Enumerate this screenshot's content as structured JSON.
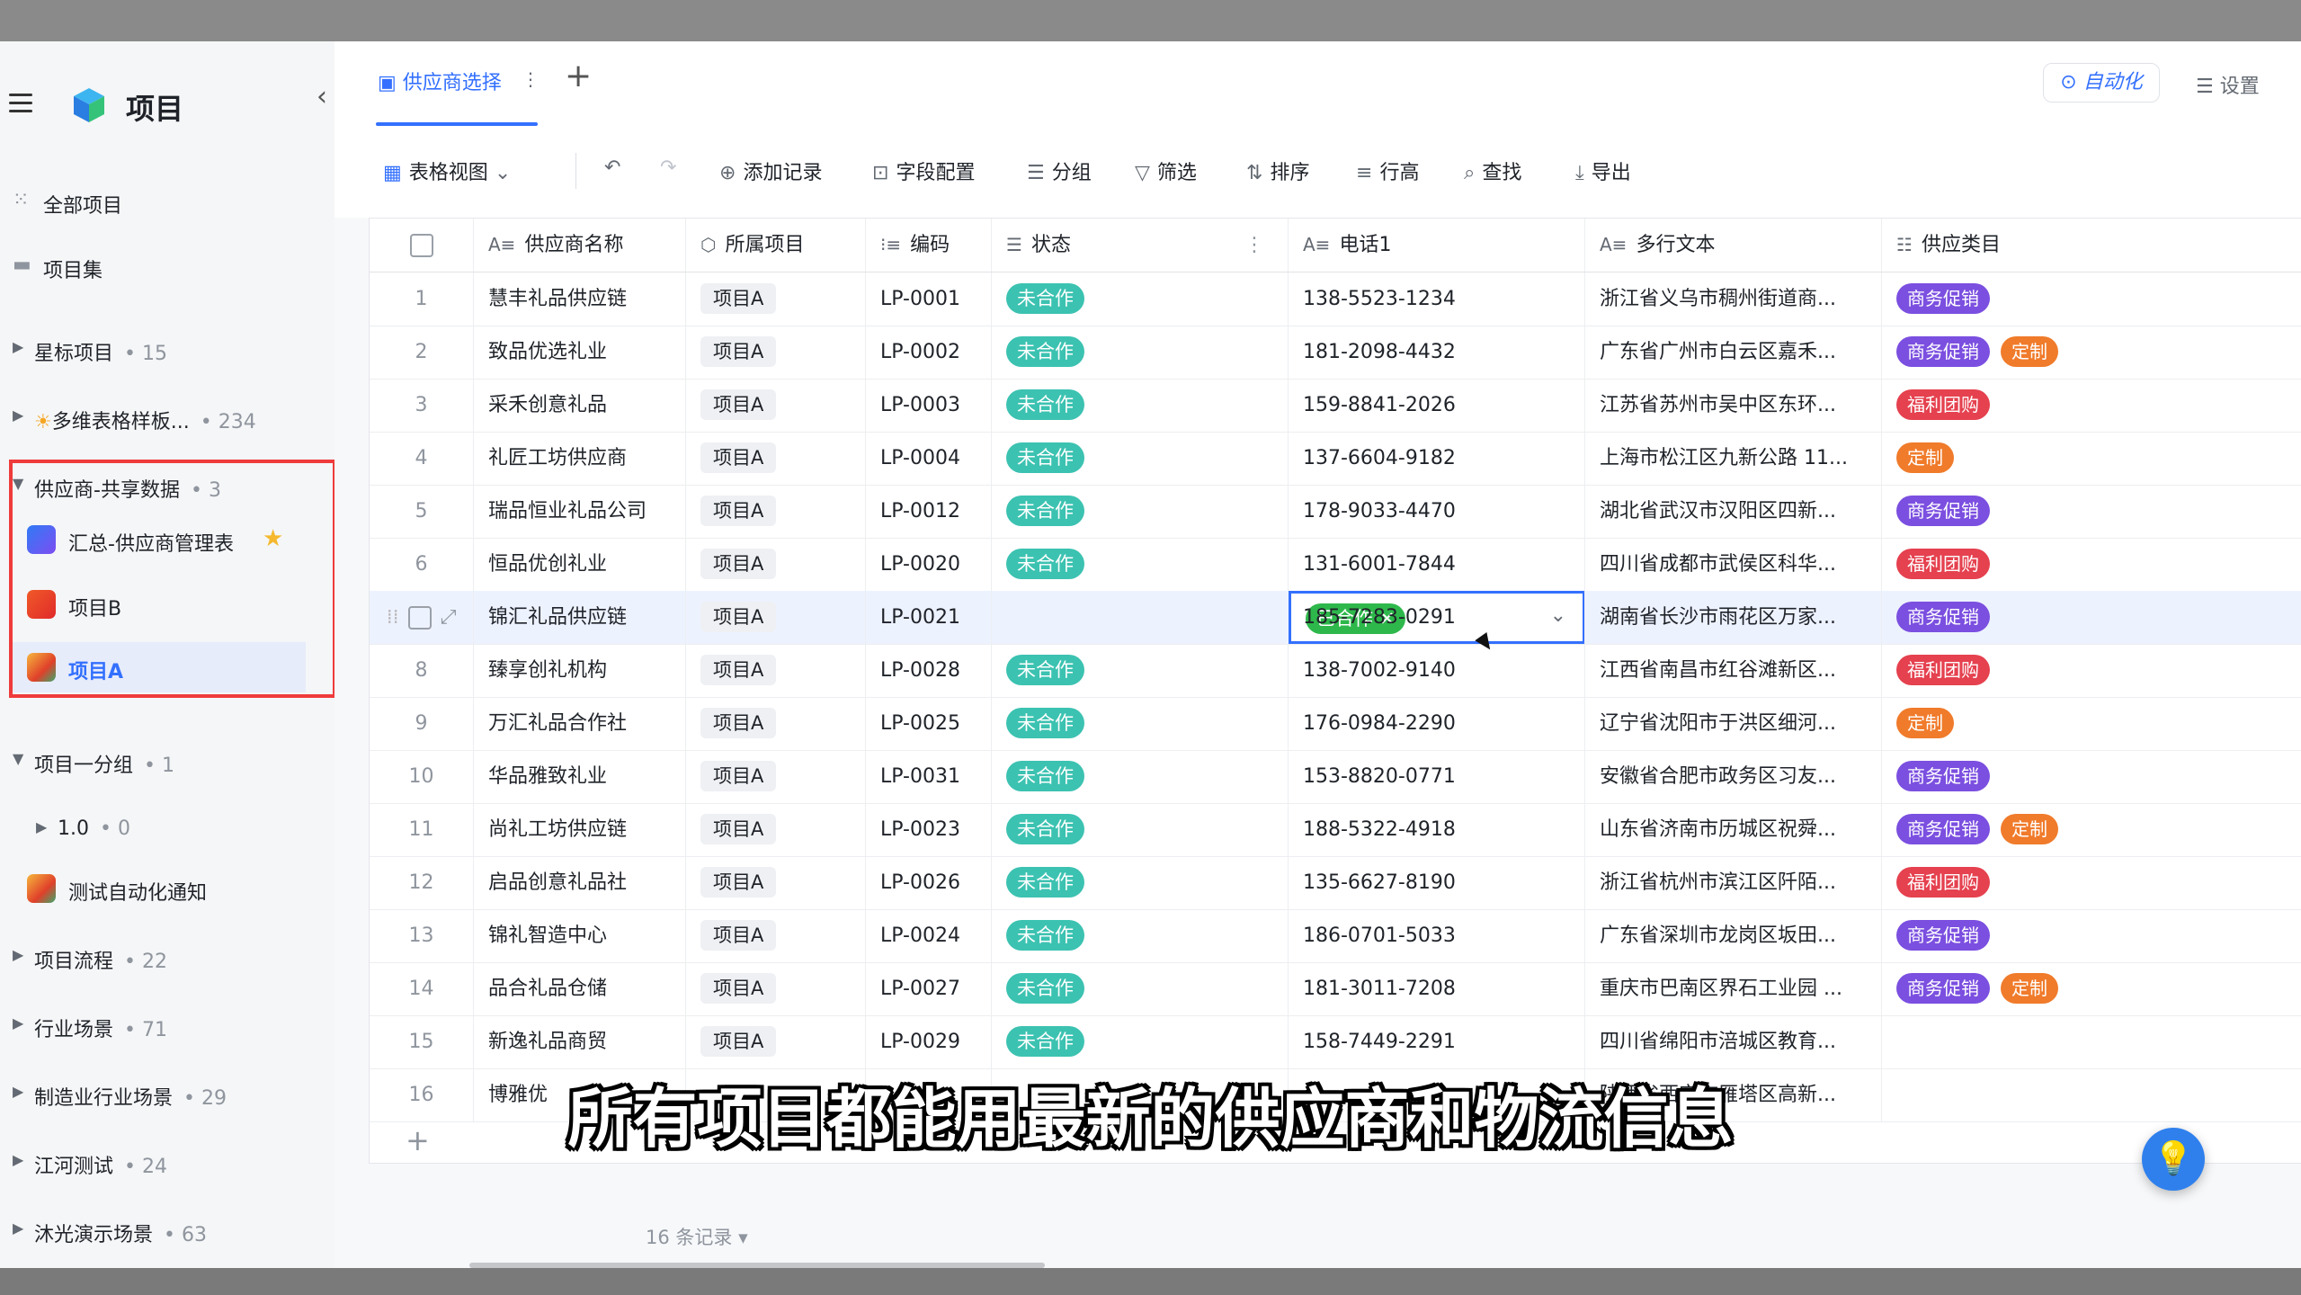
{
  "sidebar": {
    "title": "项目",
    "items": [
      {
        "label": "全部项目"
      },
      {
        "label": "项目集"
      }
    ],
    "groups": [
      {
        "label": "星标项目",
        "count": "15"
      },
      {
        "label": "多维表格样板...",
        "count": "234"
      },
      {
        "label": "供应商-共享数据",
        "count": "3"
      },
      {
        "label": "项目一分组",
        "count": "1"
      },
      {
        "label": "1.0",
        "count": "0"
      },
      {
        "label": "项目流程",
        "count": "22"
      },
      {
        "label": "行业场景",
        "count": "71"
      },
      {
        "label": "制造业行业场景",
        "count": "29"
      },
      {
        "label": "江河测试",
        "count": "24"
      },
      {
        "label": "沐光演示场景",
        "count": "63"
      }
    ],
    "apps": [
      {
        "label": "汇总-供应商管理表"
      },
      {
        "label": "项目B"
      },
      {
        "label": "项目A"
      },
      {
        "label": "测试自动化通知"
      }
    ]
  },
  "tabs": {
    "active": "供应商选择",
    "automation": "自动化",
    "settings": "设置"
  },
  "toolbar": {
    "view": "表格视图",
    "add_record": "添加记录",
    "field_config": "字段配置",
    "group": "分组",
    "filter": "筛选",
    "sort": "排序",
    "row_height": "行高",
    "find": "查找",
    "export": "导出"
  },
  "table": {
    "columns": [
      "供应商名称",
      "所属项目",
      "编码",
      "状态",
      "电话1",
      "多行文本",
      "供应类目"
    ],
    "rows": [
      {
        "n": "1",
        "name": "慧丰礼品供应链",
        "proj": "项目A",
        "code": "LP-0001",
        "status": "未合作",
        "phone": "138-5523-1234",
        "text": "浙江省义乌市稠州街道商...",
        "tags": [
          "商务促销"
        ]
      },
      {
        "n": "2",
        "name": "致品优选礼业",
        "proj": "项目A",
        "code": "LP-0002",
        "status": "未合作",
        "phone": "181-2098-4432",
        "text": "广东省广州市白云区嘉禾...",
        "tags": [
          "商务促销",
          "定制"
        ]
      },
      {
        "n": "3",
        "name": "采禾创意礼品",
        "proj": "项目A",
        "code": "LP-0003",
        "status": "未合作",
        "phone": "159-8841-2026",
        "text": "江苏省苏州市吴中区东环...",
        "tags": [
          "福利团购"
        ]
      },
      {
        "n": "4",
        "name": "礼匠工坊供应商",
        "proj": "项目A",
        "code": "LP-0004",
        "status": "未合作",
        "phone": "137-6604-9182",
        "text": "上海市松江区九新公路 11...",
        "tags": [
          "定制"
        ]
      },
      {
        "n": "5",
        "name": "瑞品恒业礼品公司",
        "proj": "项目A",
        "code": "LP-0012",
        "status": "未合作",
        "phone": "178-9033-4470",
        "text": "湖北省武汉市汉阳区四新...",
        "tags": [
          "商务促销"
        ]
      },
      {
        "n": "6",
        "name": "恒品优创礼业",
        "proj": "项目A",
        "code": "LP-0020",
        "status": "未合作",
        "phone": "131-6001-7844",
        "text": "四川省成都市武侯区科华...",
        "tags": [
          "福利团购"
        ]
      },
      {
        "n": "7",
        "name": "锦汇礼品供应链",
        "proj": "项目A",
        "code": "LP-0021",
        "status": "已合作",
        "phone": "185-7283-0291",
        "text": "湖南省长沙市雨花区万家...",
        "tags": [
          "商务促销"
        ]
      },
      {
        "n": "8",
        "name": "臻享创礼机构",
        "proj": "项目A",
        "code": "LP-0028",
        "status": "未合作",
        "phone": "138-7002-9140",
        "text": "江西省南昌市红谷滩新区...",
        "tags": [
          "福利团购"
        ]
      },
      {
        "n": "9",
        "name": "万汇礼品合作社",
        "proj": "项目A",
        "code": "LP-0025",
        "status": "未合作",
        "phone": "176-0984-2290",
        "text": "辽宁省沈阳市于洪区细河...",
        "tags": [
          "定制"
        ]
      },
      {
        "n": "10",
        "name": "华品雅致礼业",
        "proj": "项目A",
        "code": "LP-0031",
        "status": "未合作",
        "phone": "153-8820-0771",
        "text": "安徽省合肥市政务区习友...",
        "tags": [
          "商务促销"
        ]
      },
      {
        "n": "11",
        "name": "尚礼工坊供应链",
        "proj": "项目A",
        "code": "LP-0023",
        "status": "未合作",
        "phone": "188-5322-4918",
        "text": "山东省济南市历城区祝舜...",
        "tags": [
          "商务促销",
          "定制"
        ]
      },
      {
        "n": "12",
        "name": "启品创意礼品社",
        "proj": "项目A",
        "code": "LP-0026",
        "status": "未合作",
        "phone": "135-6627-8190",
        "text": "浙江省杭州市滨江区阡陌...",
        "tags": [
          "福利团购"
        ]
      },
      {
        "n": "13",
        "name": "锦礼智造中心",
        "proj": "项目A",
        "code": "LP-0024",
        "status": "未合作",
        "phone": "186-0701-5033",
        "text": "广东省深圳市龙岗区坂田...",
        "tags": [
          "商务促销"
        ]
      },
      {
        "n": "14",
        "name": "品合礼品仓储",
        "proj": "项目A",
        "code": "LP-0027",
        "status": "未合作",
        "phone": "181-3011-7208",
        "text": "重庆市巴南区界石工业园 ...",
        "tags": [
          "商务促销",
          "定制"
        ]
      },
      {
        "n": "15",
        "name": "新逸礼品商贸",
        "proj": "项目A",
        "code": "LP-0029",
        "status": "未合作",
        "phone": "158-7449-2291",
        "text": "四川省绵阳市涪城区教育...",
        "tags": []
      },
      {
        "n": "16",
        "name": "博雅优",
        "proj": "",
        "code": "",
        "status": "",
        "phone": "",
        "text": "陕西省西安市雁塔区高新...",
        "tags": []
      }
    ],
    "record_count": "16 条记录"
  },
  "tag_colors": {
    "商务促销": "#7b4fe0",
    "定制": "#f07b2b",
    "福利团购": "#e5414f"
  },
  "subtitle": "所有项目都能用最新的供应商和物流信息"
}
